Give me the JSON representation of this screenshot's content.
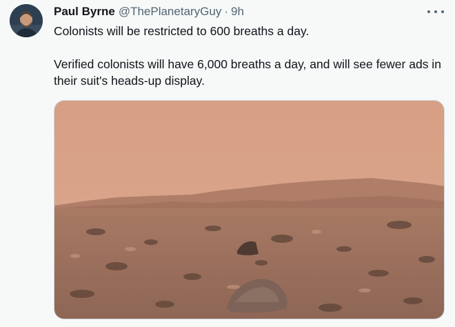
{
  "tweet": {
    "author_name": "Paul Byrne",
    "handle": "@ThePlanetaryGuy",
    "separator": "·",
    "time": "9h",
    "paragraphs": [
      "Colonists will be restricted to 600 breaths a day.",
      "Verified colonists will have 6,000 breaths a day, and will see fewer ads in their suit's heads-up display."
    ],
    "avatar_icon": "profile-photo",
    "more_icon": "more-horizontal-icon"
  },
  "media": {
    "description_icon": "mars-landscape-photo",
    "sky_color": "#d9a287",
    "ground_color": "#9a7260"
  }
}
